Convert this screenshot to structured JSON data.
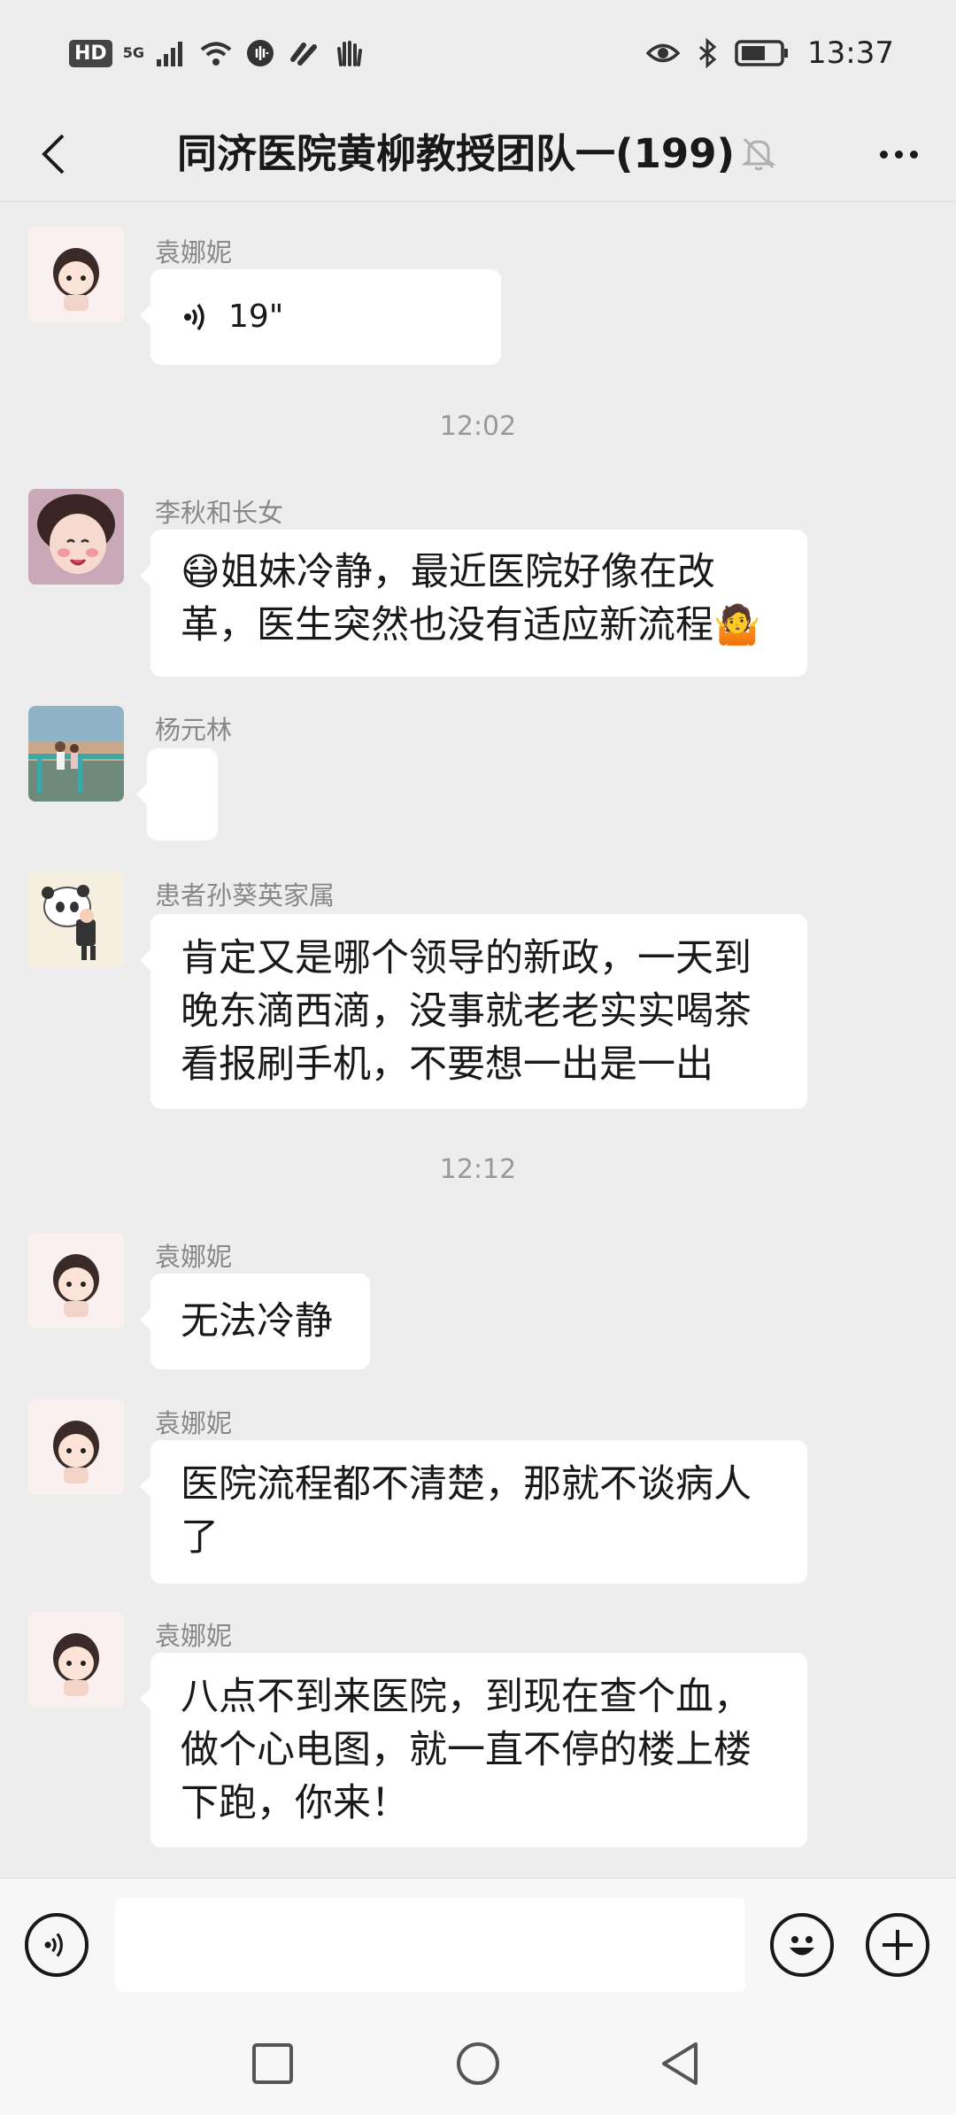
{
  "status_bar": {
    "hd": "HD",
    "network": "5G",
    "time": "13:37",
    "icons": [
      "signal-icon",
      "wifi-icon",
      "voice-icon",
      "link-icon",
      "hand-icon",
      "eye-icon",
      "bluetooth-icon",
      "battery-icon"
    ]
  },
  "header": {
    "title": "同济医院黄柳教授团队一(199)",
    "back_icon": "chevron-left-icon",
    "mute_icon": "bell-off-icon",
    "more_icon": "more-icon"
  },
  "messages": [
    {
      "sender": "袁娜妮",
      "type": "voice",
      "duration": "19\""
    },
    {
      "timestamp": "12:02"
    },
    {
      "sender": "李秋和长女",
      "line1": "😷姐妹冷静，最近医院好像在改",
      "line2": "革，医生突然也没有适应新流程🤷"
    },
    {
      "sender": "杨元林",
      "type": "empty"
    },
    {
      "sender": "患者孙葵英家属",
      "line1": "肯定又是哪个领导的新政，一天到",
      "line2": "晚东滴西滴，没事就老老实实喝茶",
      "line3": "看报刷手机，不要想一出是一出"
    },
    {
      "timestamp": "12:12"
    },
    {
      "sender": "袁娜妮",
      "line1": "无法冷静"
    },
    {
      "sender": "袁娜妮",
      "line1": "医院流程都不清楚，那就不谈病人",
      "line2": "了"
    },
    {
      "sender": "袁娜妮",
      "line1": "八点不到来医院，到现在查个血，",
      "line2": "做个心电图，就一直不停的楼上楼",
      "line3": "下跑，你来！"
    }
  ],
  "input_bar": {
    "voice_icon": "voice-input-icon",
    "input_value": "",
    "emoji_icon": "emoji-icon",
    "plus_icon": "plus-icon"
  },
  "nav_bar": {
    "icons": [
      "recents-square-icon",
      "home-circle-icon",
      "back-triangle-icon"
    ]
  }
}
